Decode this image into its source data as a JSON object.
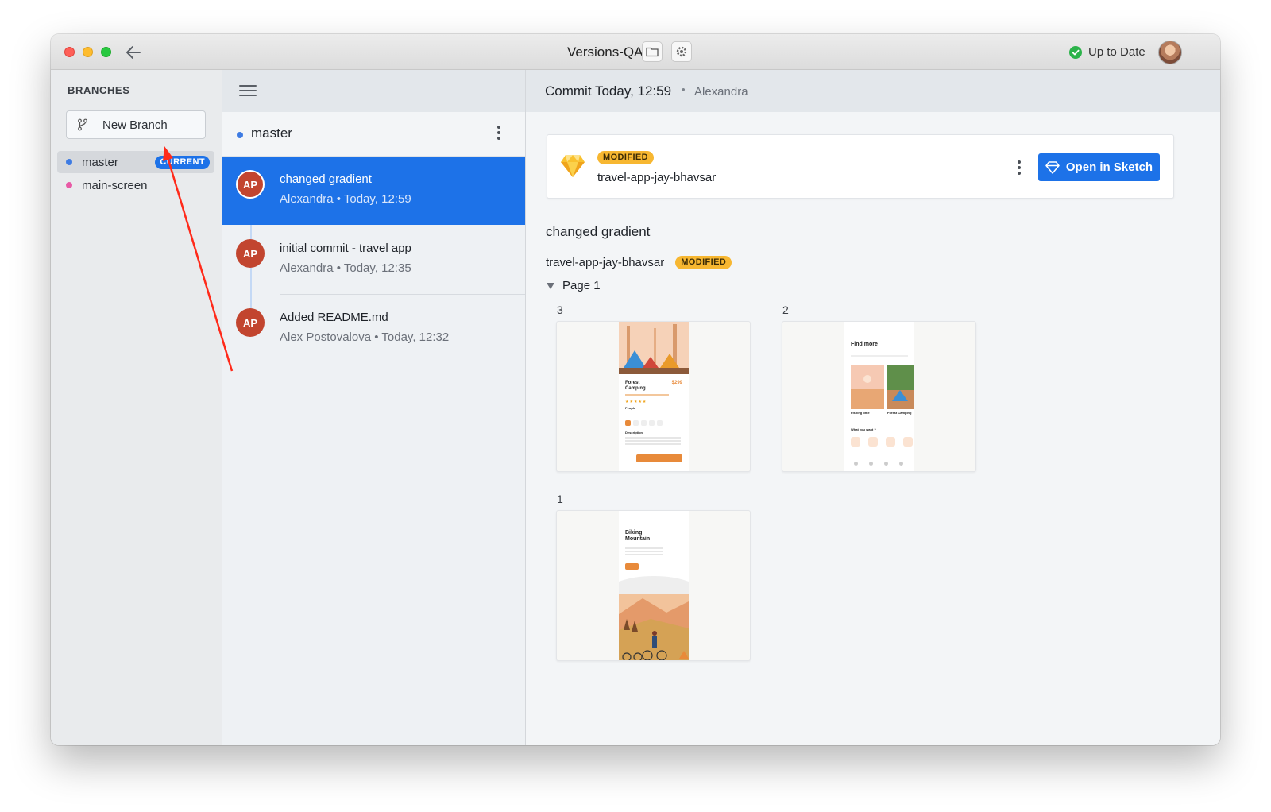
{
  "window": {
    "title": "Versions-QA",
    "status": "Up to Date",
    "status_color": "#2cb34a"
  },
  "icons": {
    "back": "arrow-left-icon",
    "folder": "folder-icon",
    "settings": "gear-icon",
    "status": "check-circle-icon",
    "menu": "hamburger-icon",
    "branch": "git-branch-icon",
    "more": "vertical-dots-icon",
    "sketch": "sketch-diamond-icon",
    "disclosure": "triangle-down-icon"
  },
  "sidebar": {
    "heading": "BRANCHES",
    "new_branch_label": "New Branch",
    "branches": [
      {
        "name": "master",
        "dot_color": "#3d7be3",
        "badge": "CURRENT"
      },
      {
        "name": "main-screen",
        "dot_color": "#e85aa6",
        "badge": ""
      }
    ]
  },
  "commits": {
    "branch_name": "master",
    "items": [
      {
        "avatar": "AP",
        "title": "changed gradient",
        "author": "Alexandra",
        "time": "Today, 12:59"
      },
      {
        "avatar": "AP",
        "title": "initial commit - travel app",
        "author": "Alexandra",
        "time": "Today, 12:35"
      },
      {
        "avatar": "AP",
        "title": "Added README.md",
        "author": "Alex Postovalova",
        "time": "Today, 12:32"
      }
    ]
  },
  "detail": {
    "header_title": "Commit Today, 12:59",
    "header_author": "Alexandra",
    "file_badge": "MODIFIED",
    "file_name": "travel-app-jay-bhavsar",
    "open_button": "Open in Sketch",
    "commit_message": "changed gradient",
    "file_line_name": "travel-app-jay-bhavsar",
    "file_line_badge": "MODIFIED",
    "page_name": "Page 1",
    "artboards": [
      {
        "number": "3",
        "screen_title": "Forest Camping",
        "price": "$299",
        "section_1": "People",
        "section_2": "Description"
      },
      {
        "number": "2",
        "screen_title": "Find more",
        "card_1": "Fishing time",
        "card_2": "Forest Camping",
        "section": "What you want ?"
      },
      {
        "number": "1",
        "screen_title": "Biking Mountain"
      }
    ]
  },
  "colors": {
    "accent": "#1d72e8",
    "modified_badge": "#f7b731",
    "avatar": "#c2452f",
    "annotation_arrow": "#ff2a1a"
  }
}
